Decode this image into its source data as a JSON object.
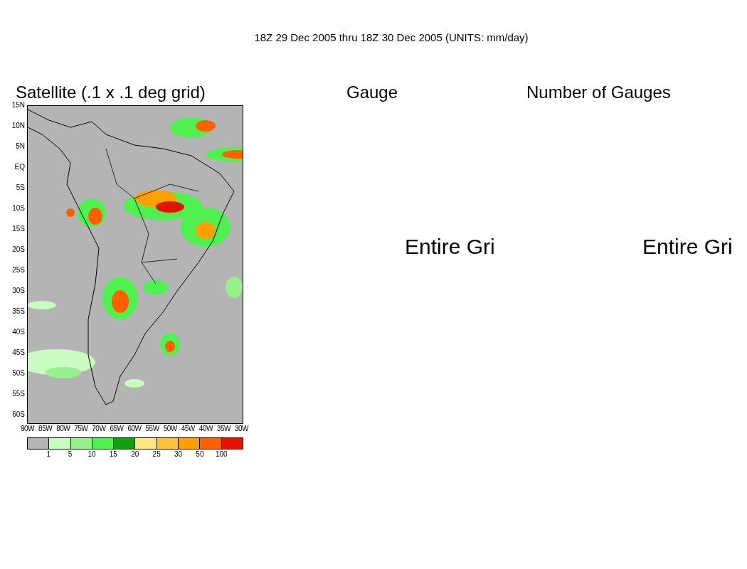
{
  "title": "18Z 29 Dec 2005 thru 18Z 30 Dec 2005 (UNITS: mm/day)",
  "panels": [
    {
      "kind": "map",
      "title": "Satellite (.1 x .1 deg grid)",
      "y_labels": [
        "15N",
        "10N",
        "5N",
        "EQ",
        "5S",
        "10S",
        "15S",
        "20S",
        "25S",
        "30S",
        "35S",
        "40S",
        "45S",
        "50S",
        "55S",
        "60S"
      ],
      "x_labels": [
        "90W",
        "85W",
        "80W",
        "75W",
        "70W",
        "65W",
        "60W",
        "55W",
        "50W",
        "45W",
        "40W",
        "35W",
        "30W"
      ],
      "colorbar": {
        "swatches": [
          {
            "color": "#b4b4b4"
          },
          {
            "color": "#c8fcc0"
          },
          {
            "color": "#98f08c"
          },
          {
            "color": "#50f050"
          },
          {
            "color": "#10a010"
          },
          {
            "color": "#fae682"
          },
          {
            "color": "#ffc03c"
          },
          {
            "color": "#ffa000"
          },
          {
            "color": "#ff6000"
          },
          {
            "color": "#e11400"
          }
        ],
        "labels": [
          "1",
          "5",
          "10",
          "15",
          "20",
          "25",
          "30",
          "50",
          "100"
        ]
      }
    },
    {
      "kind": "message",
      "title": "Gauge",
      "message": "Entire Gri"
    },
    {
      "kind": "message",
      "title": "Number of Gauges",
      "message": "Entire Gri"
    }
  ]
}
